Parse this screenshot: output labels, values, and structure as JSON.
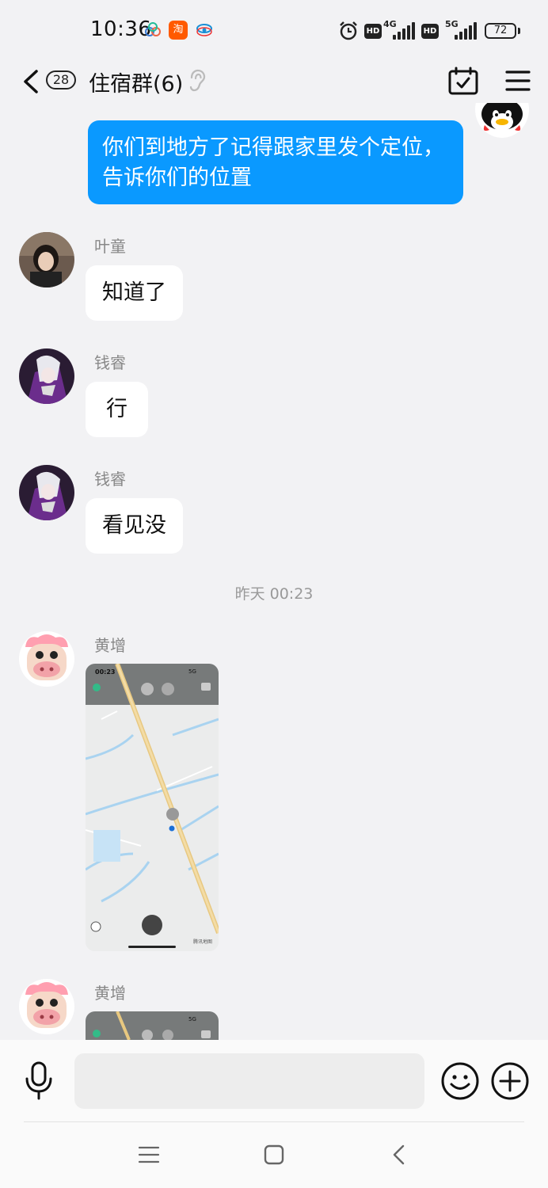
{
  "status_bar": {
    "time": "10:36",
    "app_icons": [
      "cloud-icon",
      "taobao-icon",
      "china-mobile-icon"
    ],
    "taobao_label": "淘",
    "hd_label": "HD",
    "network_1": "4G",
    "network_2": "5G",
    "battery": "72"
  },
  "header": {
    "unread_count": "28",
    "title": "住宿群(6)"
  },
  "messages": {
    "outgoing_text": "你们到地方了记得跟家里发个定位，告诉你们的位置",
    "m1": {
      "sender": "叶童",
      "text": "知道了"
    },
    "m2": {
      "sender": "钱睿",
      "text": "行"
    },
    "m3": {
      "sender": "钱睿",
      "text": "看见没"
    },
    "timestamp": "昨天 00:23",
    "m4": {
      "sender": "黄增",
      "map_time": "00:23",
      "map_net": "5G",
      "map_brand": "腾讯地图"
    },
    "m5": {
      "sender": "黄增",
      "map_net": "5G"
    }
  },
  "input": {
    "value": "",
    "placeholder": ""
  },
  "colors": {
    "accent": "#0a99ff",
    "background": "#f2f2f4",
    "bubble_in": "#ffffff"
  }
}
